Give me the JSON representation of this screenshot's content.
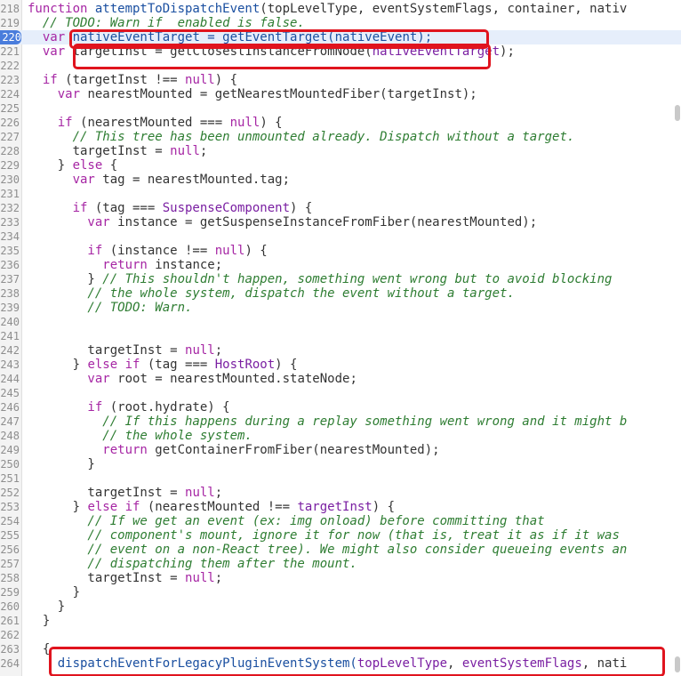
{
  "editor": {
    "lines": [
      {
        "n": "218",
        "tokens": [
          {
            "t": "function ",
            "c": "k"
          },
          {
            "t": "attemptToDispatchEvent",
            "c": "f"
          },
          {
            "t": "(topLevelType, eventSystemFlags, container, nativ",
            "c": ""
          }
        ]
      },
      {
        "n": "219",
        "tokens": [
          {
            "t": "  // TODO: Warn if  enabled is false.",
            "c": "c"
          }
        ]
      },
      {
        "n": "220",
        "hl": true,
        "tokens": [
          {
            "t": "  var ",
            "c": "k"
          },
          {
            "t": "nativeEventTarget = getEventTarget(nativeEvent);",
            "c": "f"
          }
        ]
      },
      {
        "n": "221",
        "tokens": [
          {
            "t": "  var ",
            "c": "k"
          },
          {
            "t": "targetInst = getClosestInstanceFromNode(",
            "c": ""
          },
          {
            "t": "nativeEventTarget",
            "c": "t"
          },
          {
            "t": ");",
            "c": ""
          }
        ]
      },
      {
        "n": "222",
        "tokens": []
      },
      {
        "n": "223",
        "tokens": [
          {
            "t": "  if ",
            "c": "k"
          },
          {
            "t": "(targetInst !== ",
            "c": ""
          },
          {
            "t": "null",
            "c": "k"
          },
          {
            "t": ") {",
            "c": ""
          }
        ]
      },
      {
        "n": "224",
        "tokens": [
          {
            "t": "    var ",
            "c": "k"
          },
          {
            "t": "nearestMounted = getNearestMountedFiber(targetInst);",
            "c": ""
          }
        ]
      },
      {
        "n": "225",
        "tokens": []
      },
      {
        "n": "226",
        "tokens": [
          {
            "t": "    if ",
            "c": "k"
          },
          {
            "t": "(nearestMounted === ",
            "c": ""
          },
          {
            "t": "null",
            "c": "k"
          },
          {
            "t": ") {",
            "c": ""
          }
        ]
      },
      {
        "n": "227",
        "tokens": [
          {
            "t": "      // This tree has been unmounted already. Dispatch without a target.",
            "c": "c"
          }
        ]
      },
      {
        "n": "228",
        "tokens": [
          {
            "t": "      targetInst = ",
            "c": ""
          },
          {
            "t": "null",
            "c": "k"
          },
          {
            "t": ";",
            "c": ""
          }
        ]
      },
      {
        "n": "229",
        "tokens": [
          {
            "t": "    } ",
            "c": ""
          },
          {
            "t": "else",
            "c": "k"
          },
          {
            "t": " {",
            "c": ""
          }
        ]
      },
      {
        "n": "230",
        "tokens": [
          {
            "t": "      var ",
            "c": "k"
          },
          {
            "t": "tag = nearestMounted.tag;",
            "c": ""
          }
        ]
      },
      {
        "n": "231",
        "tokens": []
      },
      {
        "n": "232",
        "tokens": [
          {
            "t": "      if ",
            "c": "k"
          },
          {
            "t": "(tag === ",
            "c": ""
          },
          {
            "t": "SuspenseComponent",
            "c": "t"
          },
          {
            "t": ") {",
            "c": ""
          }
        ]
      },
      {
        "n": "233",
        "tokens": [
          {
            "t": "        var ",
            "c": "k"
          },
          {
            "t": "instance = getSuspenseInstanceFromFiber(nearestMounted);",
            "c": ""
          }
        ]
      },
      {
        "n": "234",
        "tokens": []
      },
      {
        "n": "235",
        "tokens": [
          {
            "t": "        if ",
            "c": "k"
          },
          {
            "t": "(instance !== ",
            "c": ""
          },
          {
            "t": "null",
            "c": "k"
          },
          {
            "t": ") {",
            "c": ""
          }
        ]
      },
      {
        "n": "236",
        "tokens": [
          {
            "t": "          return ",
            "c": "k"
          },
          {
            "t": "instance;",
            "c": ""
          }
        ]
      },
      {
        "n": "237",
        "tokens": [
          {
            "t": "        } ",
            "c": ""
          },
          {
            "t": "// This shouldn't happen, something went wrong but to avoid blocking",
            "c": "c"
          }
        ]
      },
      {
        "n": "238",
        "tokens": [
          {
            "t": "        // the whole system, dispatch the event without a target.",
            "c": "c"
          }
        ]
      },
      {
        "n": "239",
        "tokens": [
          {
            "t": "        // TODO: Warn.",
            "c": "c"
          }
        ]
      },
      {
        "n": "240",
        "tokens": []
      },
      {
        "n": "241",
        "tokens": []
      },
      {
        "n": "242",
        "tokens": [
          {
            "t": "        targetInst = ",
            "c": ""
          },
          {
            "t": "null",
            "c": "k"
          },
          {
            "t": ";",
            "c": ""
          }
        ]
      },
      {
        "n": "243",
        "tokens": [
          {
            "t": "      } ",
            "c": ""
          },
          {
            "t": "else if ",
            "c": "k"
          },
          {
            "t": "(tag === ",
            "c": ""
          },
          {
            "t": "HostRoot",
            "c": "t"
          },
          {
            "t": ") {",
            "c": ""
          }
        ]
      },
      {
        "n": "244",
        "tokens": [
          {
            "t": "        var ",
            "c": "k"
          },
          {
            "t": "root = nearestMounted.stateNode;",
            "c": ""
          }
        ]
      },
      {
        "n": "245",
        "tokens": []
      },
      {
        "n": "246",
        "tokens": [
          {
            "t": "        if ",
            "c": "k"
          },
          {
            "t": "(root.hydrate) {",
            "c": ""
          }
        ]
      },
      {
        "n": "247",
        "tokens": [
          {
            "t": "          // If this happens during a replay something went wrong and it might b",
            "c": "c"
          }
        ]
      },
      {
        "n": "248",
        "tokens": [
          {
            "t": "          // the whole system.",
            "c": "c"
          }
        ]
      },
      {
        "n": "249",
        "tokens": [
          {
            "t": "          return ",
            "c": "k"
          },
          {
            "t": "getContainerFromFiber(nearestMounted);",
            "c": ""
          }
        ]
      },
      {
        "n": "250",
        "tokens": [
          {
            "t": "        }",
            "c": ""
          }
        ]
      },
      {
        "n": "251",
        "tokens": []
      },
      {
        "n": "252",
        "tokens": [
          {
            "t": "        targetInst = ",
            "c": ""
          },
          {
            "t": "null",
            "c": "k"
          },
          {
            "t": ";",
            "c": ""
          }
        ]
      },
      {
        "n": "253",
        "tokens": [
          {
            "t": "      } ",
            "c": ""
          },
          {
            "t": "else if ",
            "c": "k"
          },
          {
            "t": "(nearestMounted !== ",
            "c": ""
          },
          {
            "t": "targetInst",
            "c": "t"
          },
          {
            "t": ") {",
            "c": ""
          }
        ]
      },
      {
        "n": "254",
        "tokens": [
          {
            "t": "        // If we get an event (ex: img onload) before committing that",
            "c": "c"
          }
        ]
      },
      {
        "n": "255",
        "tokens": [
          {
            "t": "        // component's mount, ignore it for now (that is, treat it as if it was",
            "c": "c"
          }
        ]
      },
      {
        "n": "256",
        "tokens": [
          {
            "t": "        // event on a non-React tree). We might also consider queueing events an",
            "c": "c"
          }
        ]
      },
      {
        "n": "257",
        "tokens": [
          {
            "t": "        // dispatching them after the mount.",
            "c": "c"
          }
        ]
      },
      {
        "n": "258",
        "tokens": [
          {
            "t": "        targetInst = ",
            "c": ""
          },
          {
            "t": "null",
            "c": "k"
          },
          {
            "t": ";",
            "c": ""
          }
        ]
      },
      {
        "n": "259",
        "tokens": [
          {
            "t": "      }",
            "c": ""
          }
        ]
      },
      {
        "n": "260",
        "tokens": [
          {
            "t": "    }",
            "c": ""
          }
        ]
      },
      {
        "n": "261",
        "tokens": [
          {
            "t": "  }",
            "c": ""
          }
        ]
      },
      {
        "n": "262",
        "tokens": []
      },
      {
        "n": "263",
        "tokens": [
          {
            "t": "  {",
            "c": ""
          }
        ]
      },
      {
        "n": "264",
        "tokens": [
          {
            "t": "    dispatchEventForLegacyPluginEventSystem(",
            "c": "f"
          },
          {
            "t": "topLevelType",
            "c": "t"
          },
          {
            "t": ", ",
            "c": ""
          },
          {
            "t": "eventSystemFlags",
            "c": "t"
          },
          {
            "t": ", nati",
            "c": ""
          }
        ]
      }
    ]
  }
}
